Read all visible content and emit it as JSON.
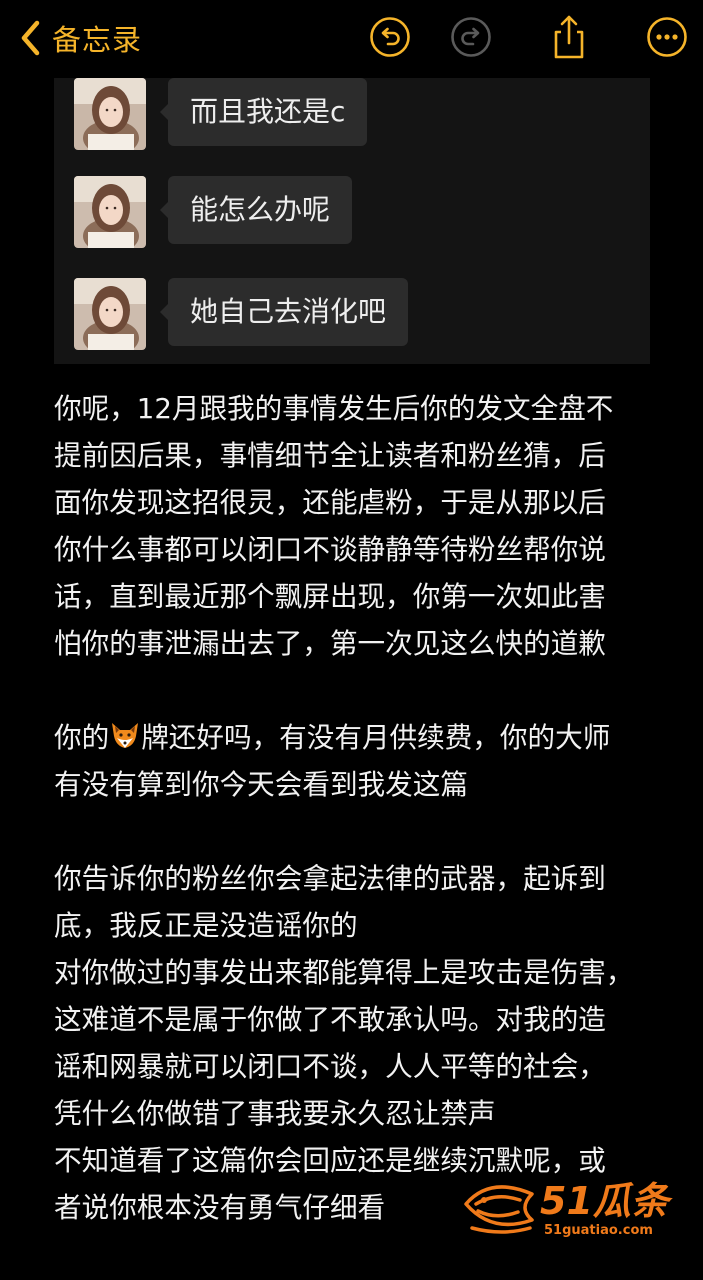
{
  "navbar": {
    "back_label": "备忘录",
    "icons": [
      "undo-icon",
      "redo-icon",
      "share-icon",
      "more-icon"
    ]
  },
  "chat_screenshot": {
    "messages": [
      {
        "text": "而且我还是c"
      },
      {
        "text": "能怎么办呢"
      },
      {
        "text": "她自己去消化吧"
      }
    ]
  },
  "note": {
    "para1": [
      "你呢，12月跟我的事情发生后你的发文全盘不",
      "提前因后果，事情细节全让读者和粉丝猜，后",
      "面你发现这招很灵，还能虐粉，于是从那以后",
      "你什么事都可以闭口不谈静静等待粉丝帮你说",
      "话，直到最近那个飘屏出现，你第一次如此害",
      "怕你的事泄漏出去了，第一次见这么快的道歉"
    ],
    "para2_line1_before_emoji": "你的",
    "para2_line1_after_emoji": "牌还好吗，有没有月供续费，你的大师",
    "para2_line2": "有没有算到你今天会看到我发这篇",
    "para3": [
      "你告诉你的粉丝你会拿起法律的武器，起诉到",
      "底，我反正是没造谣你的",
      "对你做过的事发出来都能算得上是攻击是伤害，",
      "这难道不是属于你做了不敢承认吗。对我的造",
      "谣和网暴就可以闭口不谈，人人平等的社会，",
      "凭什么你做错了事我要永久忍让禁声",
      "不知道看了这篇你会回应还是继续沉默呢，或",
      "者说你根本没有勇气仔细看"
    ]
  },
  "watermark": {
    "brand": "51瓜条",
    "url": "51guatiao.com"
  },
  "colors": {
    "accent": "#f5b42a",
    "background": "#000000",
    "chat_bg": "#141414",
    "bubble": "#2c2c2c",
    "watermark": "#f07a1a"
  }
}
